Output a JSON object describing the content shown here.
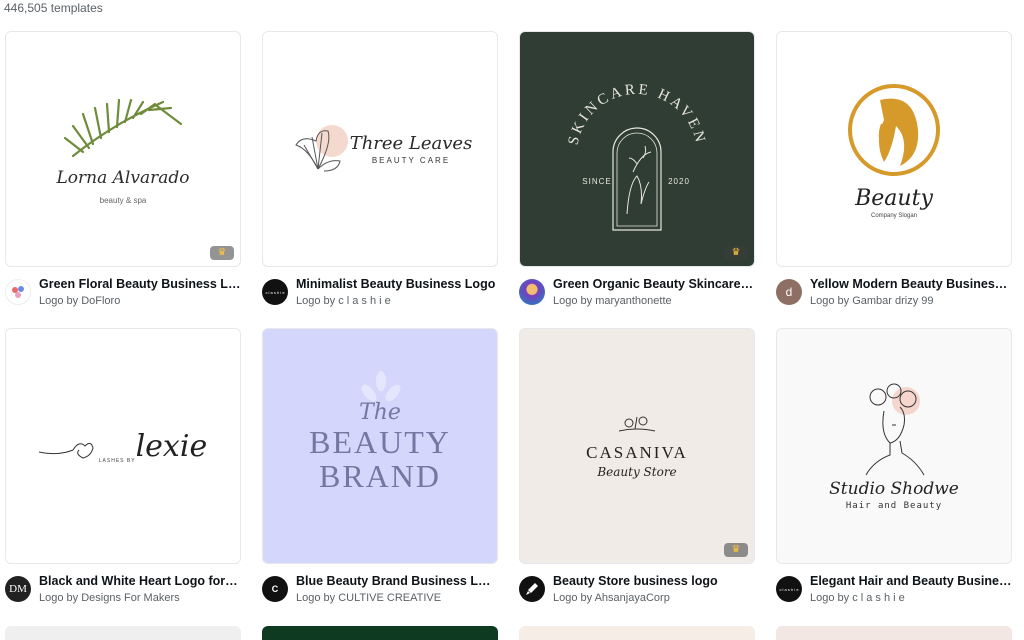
{
  "count_label": "446,505 templates",
  "premium_icon": "crown-icon",
  "cards": [
    {
      "title": "Green Floral Beauty Business Logo",
      "byline": "Logo by DoFloro",
      "avatar_text": "",
      "thumb": {
        "line1": "Lorna Alvarado",
        "line2": "beauty & spa"
      }
    },
    {
      "title": "Minimalist Beauty Business Logo",
      "byline": "Logo by c l a s h i e",
      "avatar_text": "c l a s h i e",
      "thumb": {
        "line1": "Three Leaves",
        "line2": "BEAUTY CARE"
      }
    },
    {
      "title": "Green Organic Beauty Skincare B...",
      "byline": "Logo by maryanthonette",
      "avatar_text": "",
      "thumb": {
        "line1": "SKINCARE HAVEN",
        "since": "SINCE",
        "year": "2020"
      }
    },
    {
      "title": "Yellow Modern Beauty Business L...",
      "byline": "Logo by Gambar drizy 99",
      "avatar_text": "d",
      "thumb": {
        "line1": "Beauty",
        "line2": "Company Slogan"
      }
    },
    {
      "title": "Black and White Heart Logo for B...",
      "byline": "Logo by Designs For Makers",
      "avatar_text": "DM",
      "thumb": {
        "line1": "lexie",
        "line2": "LASHES BY"
      }
    },
    {
      "title": "Blue Beauty Brand Business Logo",
      "byline": "Logo by CULTIVE CREATIVE",
      "avatar_text": "C",
      "thumb": {
        "line1": "The",
        "line2": "BEAUTY",
        "line3": "BRAND"
      }
    },
    {
      "title": "Beauty Store business logo",
      "byline": "Logo by AhsanjayaCorp",
      "avatar_text": "",
      "thumb": {
        "line1": "CASANIVA",
        "line2": "Beauty Store"
      }
    },
    {
      "title": "Elegant Hair and Beauty Business ...",
      "byline": "Logo by c l a s h i e",
      "avatar_text": "c l a s h i e",
      "thumb": {
        "line1": "Studio Shodwe",
        "line2": "Hair and Beauty"
      }
    }
  ]
}
